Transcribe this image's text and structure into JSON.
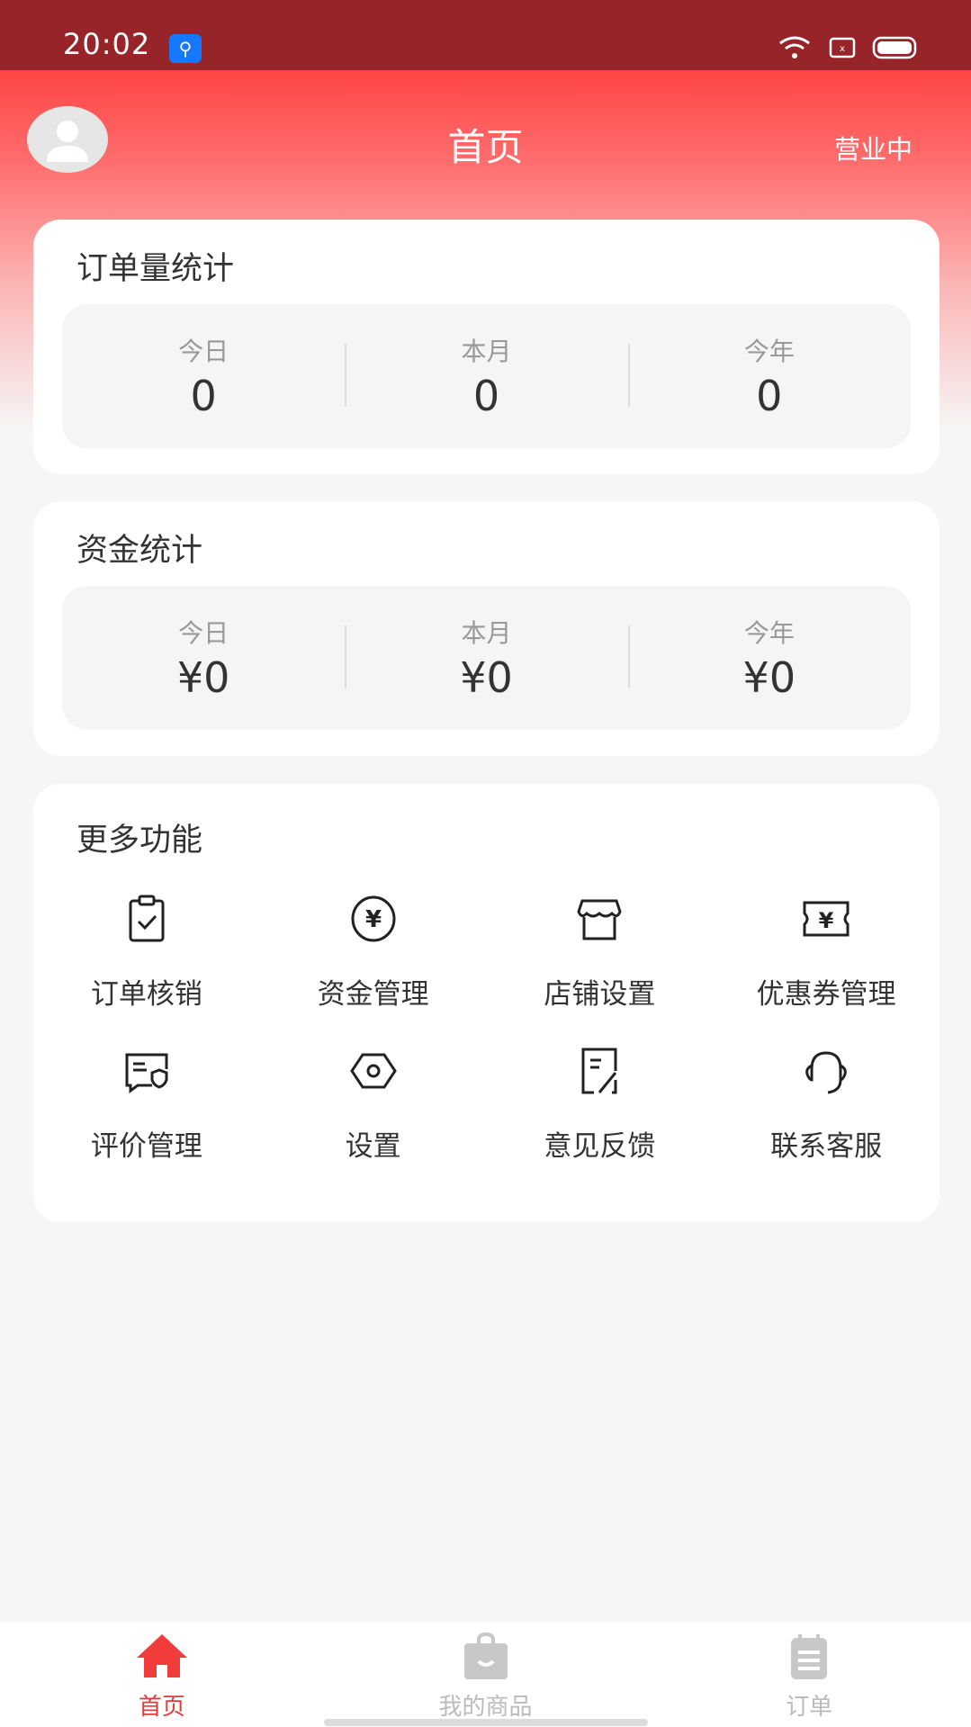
{
  "status_bar": {
    "time": "20:02"
  },
  "header": {
    "title": "首页",
    "store_status": "营业中"
  },
  "order_stats": {
    "title": "订单量统计",
    "items": [
      {
        "label": "今日",
        "value": "0"
      },
      {
        "label": "本月",
        "value": "0"
      },
      {
        "label": "今年",
        "value": "0"
      }
    ]
  },
  "fund_stats": {
    "title": "资金统计",
    "items": [
      {
        "label": "今日",
        "value": "¥0"
      },
      {
        "label": "本月",
        "value": "¥0"
      },
      {
        "label": "今年",
        "value": "¥0"
      }
    ]
  },
  "more": {
    "title": "更多功能",
    "items": [
      {
        "label": "订单核销",
        "icon": "clipboard-check-icon"
      },
      {
        "label": "资金管理",
        "icon": "yen-coin-icon"
      },
      {
        "label": "店铺设置",
        "icon": "store-icon"
      },
      {
        "label": "优惠券管理",
        "icon": "coupon-icon"
      },
      {
        "label": "评价管理",
        "icon": "review-icon"
      },
      {
        "label": "设置",
        "icon": "settings-icon"
      },
      {
        "label": "意见反馈",
        "icon": "feedback-icon"
      },
      {
        "label": "联系客服",
        "icon": "headset-icon"
      }
    ]
  },
  "tabbar": {
    "items": [
      {
        "label": "首页",
        "active": true
      },
      {
        "label": "我的商品",
        "active": false
      },
      {
        "label": "订单",
        "active": false
      }
    ]
  },
  "colors": {
    "accent": "#e33b3b",
    "status_bar": "#962428"
  }
}
